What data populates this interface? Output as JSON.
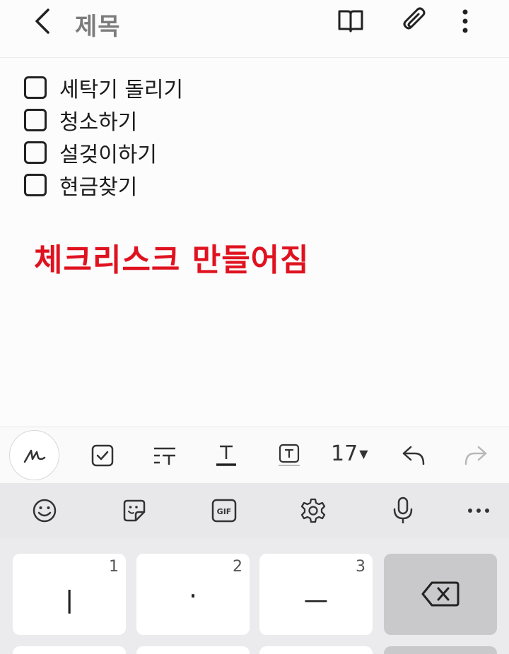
{
  "header": {
    "title": "제목",
    "icons": [
      "back-icon",
      "book-icon",
      "paperclip-icon",
      "more-vert-icon"
    ]
  },
  "checklist": {
    "items": [
      {
        "label": "세탁기 돌리기",
        "checked": false
      },
      {
        "label": "청소하기",
        "checked": false
      },
      {
        "label": "설겆이하기",
        "checked": false
      },
      {
        "label": "현금찾기",
        "checked": false
      }
    ]
  },
  "annotation": {
    "text": "체크리스크 만들어짐",
    "color": "#e0121f"
  },
  "toolbar": {
    "icons": [
      "handwriting-icon",
      "checkbox-icon",
      "text-style-icon",
      "text-underline-icon",
      "text-box-icon",
      "undo-icon",
      "redo-icon"
    ],
    "font_size": "17"
  },
  "keyboard": {
    "top_icons": [
      "emoji-icon",
      "sticker-icon",
      "gif-icon",
      "settings-icon",
      "mic-icon",
      "more-horiz-icon"
    ],
    "gif_label": "GIF",
    "keys": [
      {
        "num": "1",
        "glyph": "ㅣ"
      },
      {
        "num": "2",
        "glyph": "·"
      },
      {
        "num": "3",
        "glyph": "ㅡ"
      }
    ]
  }
}
